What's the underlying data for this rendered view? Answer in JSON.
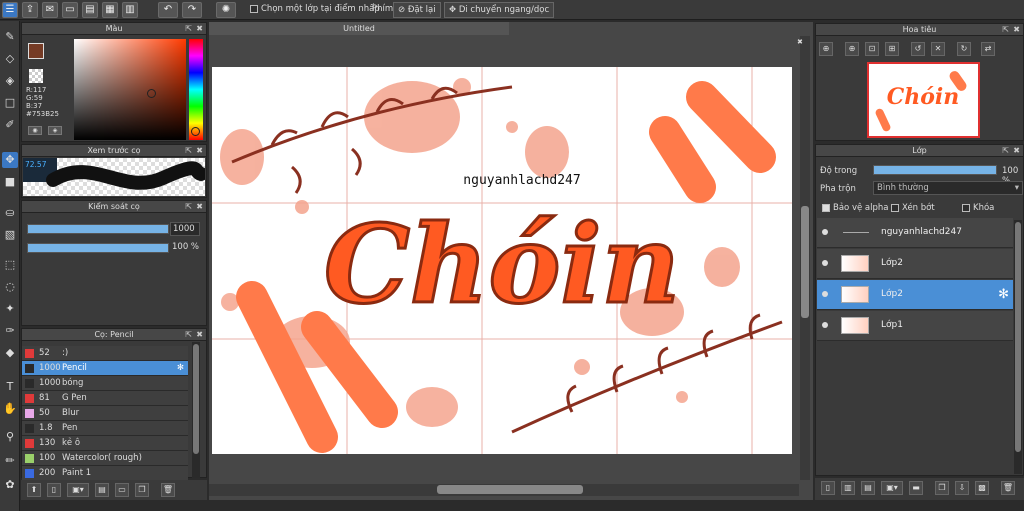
{
  "topbar": {
    "select_layer_label": "Chọn một lớp tại điểm nhấp",
    "shortcut_label": "Phím",
    "reset_label": "Đặt lại",
    "pan_label": "Di chuyển ngang/dọc"
  },
  "canvas": {
    "tab_title": "Untitled",
    "watermark_text": "nguyanhlachd247",
    "artwork_text": "Chóin"
  },
  "color_panel": {
    "title": "Màu",
    "r": "R:117",
    "g": "G:59",
    "b": "B:37",
    "hex": "#753B25",
    "primary_color": "#753B25",
    "secondary_color": "#2f4fd6"
  },
  "brush_preview": {
    "title": "Xem trước cọ",
    "size_value": "72.57"
  },
  "brush_control": {
    "title": "Kiểm soát cọ",
    "size_value": "1000",
    "size_fraction": 1.0,
    "opacity_value": "100 %",
    "opacity_fraction": 1.0
  },
  "brush_list": {
    "title": "Cọ: Pencil",
    "items": [
      {
        "size": "52",
        "name": ":)",
        "color": "#e03a3a"
      },
      {
        "size": "1000",
        "name": "Pencil",
        "color": "#2a2a2a"
      },
      {
        "size": "1000",
        "name": "bóng",
        "color": "#2a2a2a"
      },
      {
        "size": "81",
        "name": "G Pen",
        "color": "#e03a3a"
      },
      {
        "size": "50",
        "name": "Blur",
        "color": "#e8a8e8"
      },
      {
        "size": "1.8",
        "name": "Pen",
        "color": "#2a2a2a"
      },
      {
        "size": "130",
        "name": "kẻ ô",
        "color": "#e03a3a"
      },
      {
        "size": "100",
        "name": "Watercolor( rough)",
        "color": "#9ad06a"
      },
      {
        "size": "200",
        "name": "Paint 1",
        "color": "#3a6ae0"
      }
    ]
  },
  "navigator": {
    "title": "Hoa tiêu"
  },
  "layer_panel": {
    "title": "Lớp",
    "opacity_label": "Độ trong",
    "opacity_value": "100 %",
    "opacity_fraction": 1.0,
    "blend_label": "Pha trộn",
    "blend_value": "Bình thường",
    "protect_alpha_label": "Bảo vệ alpha",
    "clipping_label": "Xén bớt",
    "lock_label": "Khóa",
    "layers": [
      {
        "name": "nguyanhlachd247"
      },
      {
        "name": "Lớp2"
      },
      {
        "name": "Lớp2"
      },
      {
        "name": "Lớp1"
      }
    ]
  }
}
